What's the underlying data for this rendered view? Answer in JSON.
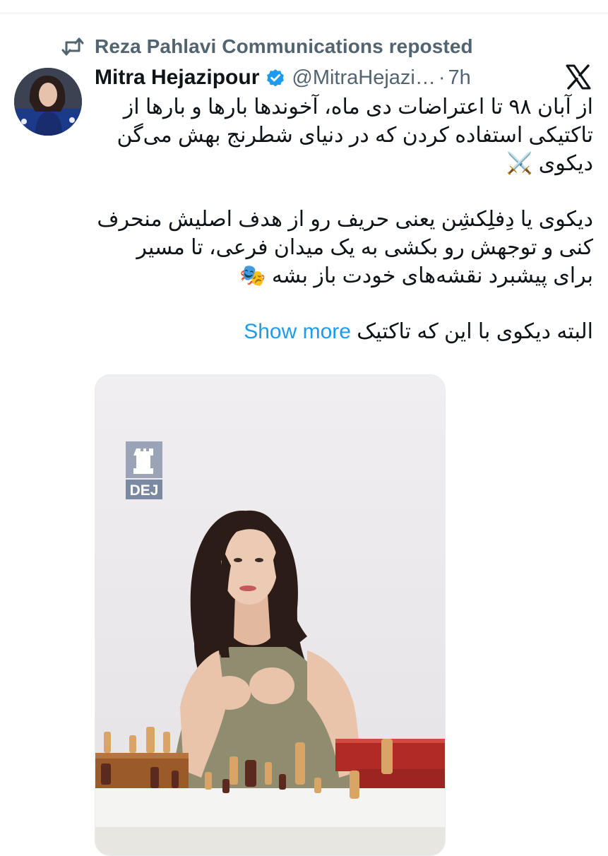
{
  "repost": {
    "label": "Reza Pahlavi Communications reposted"
  },
  "author": {
    "name": "Mitra Hejazipour",
    "handle": "@MitraHejazi…",
    "separator": "·",
    "time": "7h"
  },
  "tweet": {
    "paragraphs": [
      "از آبان ۹۸ تا اعتراضات دی ماه، آخوندها بارها و بارها از تاکتیکی استفاده کردن که در دنیای شطرنج بهش می‌گن دیکوی ⚔️",
      "دیکوی یا دِفلِکشِن یعنی حریف رو از هدف اصلیش منحرف کنی و توجهش رو بکشی به یک میدان فرعی، تا مسیر برای پیشبرد نقشه‌های خودت باز بشه 🎭",
      "البته دیکوی با این که تاکتیک"
    ],
    "show_more": "Show more"
  },
  "media": {
    "watermark": "DEJ"
  },
  "colors": {
    "link": "#1d9bf0",
    "secondary_text": "#536471",
    "verified": "#1d9bf0",
    "divider": "#e6ecf0"
  },
  "icons": {
    "repost": "repost-icon",
    "verified": "verified-badge-icon",
    "platform": "x-logo-icon"
  }
}
